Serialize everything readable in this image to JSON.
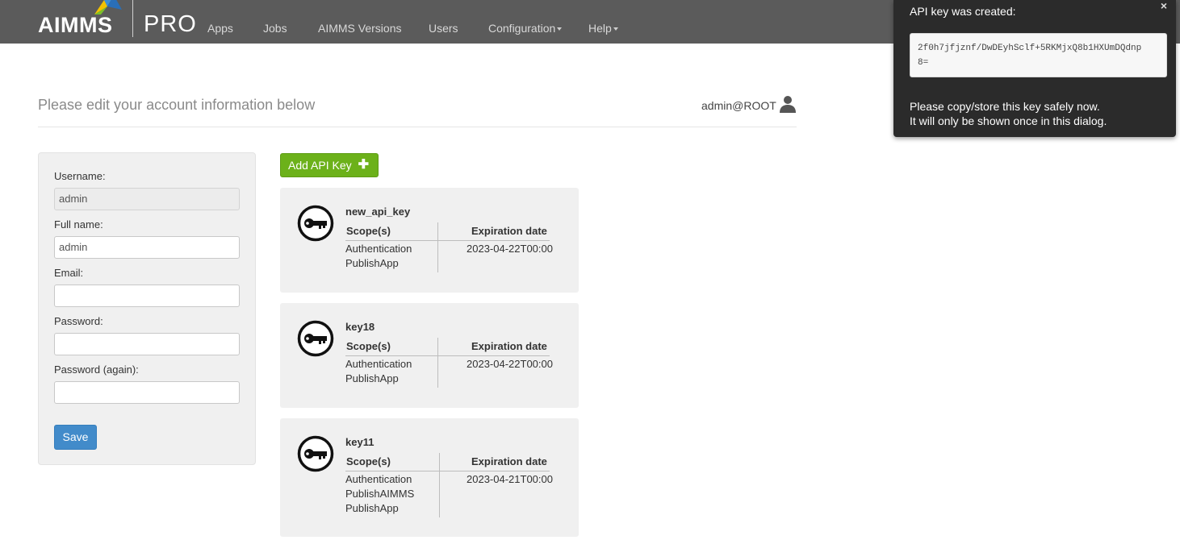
{
  "brand": {
    "left": "AIMMS",
    "right": "PRO"
  },
  "nav": {
    "items": [
      {
        "label": "Apps"
      },
      {
        "label": "Jobs"
      },
      {
        "label": "AIMMS Versions"
      },
      {
        "label": "Users"
      },
      {
        "label": "Configuration"
      },
      {
        "label": "Help"
      }
    ]
  },
  "header": {
    "title": "Please edit your account information below",
    "user": "admin@ROOT",
    "user_icon": "user-icon"
  },
  "form": {
    "username_label": "Username:",
    "username_value": "admin",
    "fullname_label": "Full name:",
    "fullname_value": "admin",
    "email_label": "Email:",
    "email_value": "",
    "password_label": "Password:",
    "password_value": "",
    "password_again_label": "Password (again):",
    "password_again_value": "",
    "save_label": "Save"
  },
  "api": {
    "add_label": "Add API Key",
    "add_icon": "plus-icon",
    "scope_header": "Scope(s)",
    "expiration_header": "Expiration date",
    "keys": [
      {
        "name": "new_api_key",
        "scopes": [
          "Authentication",
          "PublishApp"
        ],
        "expiration": "2023-04-22T00:00"
      },
      {
        "name": "key18",
        "scopes": [
          "Authentication",
          "PublishApp"
        ],
        "expiration": "2023-04-22T00:00"
      },
      {
        "name": "key11",
        "scopes": [
          "Authentication",
          "PublishAIMMS",
          "PublishApp"
        ],
        "expiration": "2023-04-21T00:00"
      }
    ]
  },
  "toast": {
    "title": "API key was created:",
    "close": "×",
    "key_line1": "2f0h7jfjznf/DwDEyhSclf+5RKMjxQ8b1HXUmDQdnp",
    "key_line2": "8=",
    "message_line1": "Please copy/store this key safely now.",
    "message_line2": "It will only be shown once in this dialog."
  },
  "colors": {
    "navbar": "#5b5b5b",
    "primary": "#428bca",
    "success": "#6cb11a",
    "toast": "#2b2b2b"
  }
}
